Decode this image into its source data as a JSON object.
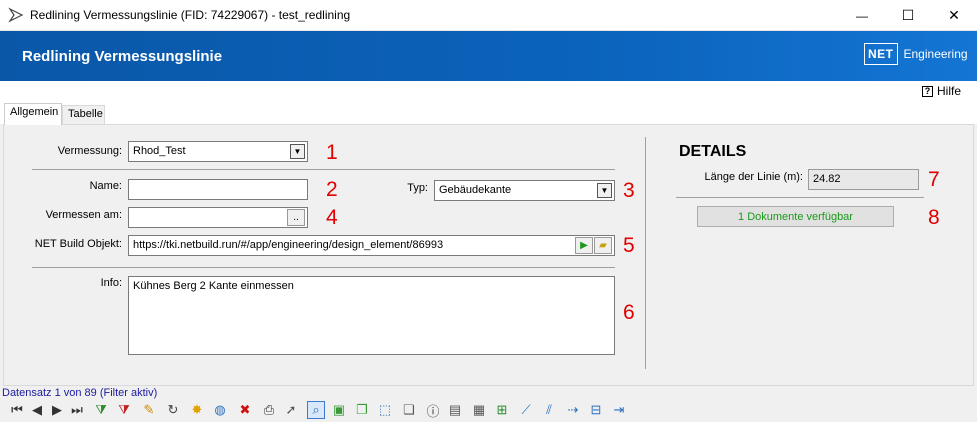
{
  "window": {
    "title": "Redlining Vermessungslinie (FID: 74229067) - test_redlining",
    "minimize_glyph": "—",
    "maximize_glyph": "☐",
    "close_glyph": "✕"
  },
  "header": {
    "title": "Redlining Vermessungslinie",
    "brand_logo": "NET",
    "brand_text": "Engineering"
  },
  "help": {
    "icon_glyph": "?",
    "label": "Hilfe"
  },
  "tabs": [
    {
      "label": "Allgemein",
      "active": true
    },
    {
      "label": "Tabelle",
      "active": false
    }
  ],
  "form": {
    "vermessung": {
      "label": "Vermessung:",
      "value": "Rhod_Test",
      "marker": "1"
    },
    "name": {
      "label": "Name:",
      "value": "",
      "marker": "2"
    },
    "typ": {
      "label": "Typ:",
      "value": "Gebäudekante",
      "marker": "3"
    },
    "vermessen_am": {
      "label": "Vermessen am:",
      "value": "",
      "button": "..",
      "marker": "4"
    },
    "net_build_objekt": {
      "label": "NET Build Objekt:",
      "value": "https://tki.netbuild.run/#/app/engineering/design_element/86993",
      "marker": "5"
    },
    "info": {
      "label": "Info:",
      "value": "Kühnes Berg 2 Kante einmessen",
      "marker": "6"
    }
  },
  "details": {
    "heading": "DETAILS",
    "laenge_label": "Länge der Linie (m):",
    "laenge_value": "24.82",
    "laenge_marker": "7",
    "documents_button": "1 Dokumente verfügbar",
    "documents_marker": "8"
  },
  "status": {
    "text": "Datensatz 1 von 89 (Filter aktiv)"
  },
  "colors": {
    "header_blue": "#0b63bb",
    "marker_red": "#e00000",
    "docs_green": "#1a9a1a",
    "status_blue": "#1a1aa0"
  },
  "toolbar": {
    "items": [
      {
        "name": "first-record-icon",
        "glyph": "⏮",
        "color": "#333"
      },
      {
        "name": "prev-record-icon",
        "glyph": "◀",
        "color": "#333"
      },
      {
        "name": "next-record-icon",
        "glyph": "▶",
        "color": "#333"
      },
      {
        "name": "last-record-icon",
        "glyph": "⏭",
        "color": "#333"
      },
      {
        "name": "add-filter-icon",
        "glyph": "⧩",
        "color": "#2a8a2a"
      },
      {
        "name": "remove-filter-icon",
        "glyph": "⧩",
        "color": "#c02020"
      },
      {
        "name": "edit-pencil-icon",
        "glyph": "✎",
        "color": "#d08a00"
      },
      {
        "name": "refresh-icon",
        "glyph": "↻",
        "color": "#444"
      },
      {
        "name": "highlight-icon",
        "glyph": "✸",
        "color": "#e0a000"
      },
      {
        "name": "globe-icon",
        "glyph": "◍",
        "color": "#2a70c0"
      },
      {
        "name": "delete-icon",
        "glyph": "✖",
        "color": "#d01010"
      },
      {
        "name": "print-icon",
        "glyph": "⎙",
        "color": "#333"
      },
      {
        "name": "select-cursor-icon",
        "glyph": "➚",
        "color": "#555"
      },
      {
        "name": "zoom-icon",
        "glyph": "⌕",
        "color": "#2a70c0"
      },
      {
        "name": "shape-green-icon",
        "glyph": "▣",
        "color": "#3a9a3a"
      },
      {
        "name": "shape-copy-icon",
        "glyph": "❐",
        "color": "#3a9a3a"
      },
      {
        "name": "select-area-icon",
        "glyph": "⬚",
        "color": "#2a70c0"
      },
      {
        "name": "stack-icon",
        "glyph": "❏",
        "color": "#555"
      },
      {
        "name": "info-icon",
        "glyph": "ⓘ",
        "color": "#333"
      },
      {
        "name": "report-icon",
        "glyph": "▤",
        "color": "#555"
      },
      {
        "name": "export-icon",
        "glyph": "▦",
        "color": "#555"
      },
      {
        "name": "map-add-icon",
        "glyph": "⊞",
        "color": "#2a8a2a"
      },
      {
        "name": "measure-line-icon",
        "glyph": "⟋",
        "color": "#2a70c0"
      },
      {
        "name": "measure-lines-icon",
        "glyph": "⫽",
        "color": "#2a70c0"
      },
      {
        "name": "move-points-icon",
        "glyph": "⇢",
        "color": "#2a70c0"
      },
      {
        "name": "table-edit-icon",
        "glyph": "⊟",
        "color": "#2a70c0"
      },
      {
        "name": "exit-icon",
        "glyph": "⇥",
        "color": "#2a70c0"
      }
    ]
  }
}
